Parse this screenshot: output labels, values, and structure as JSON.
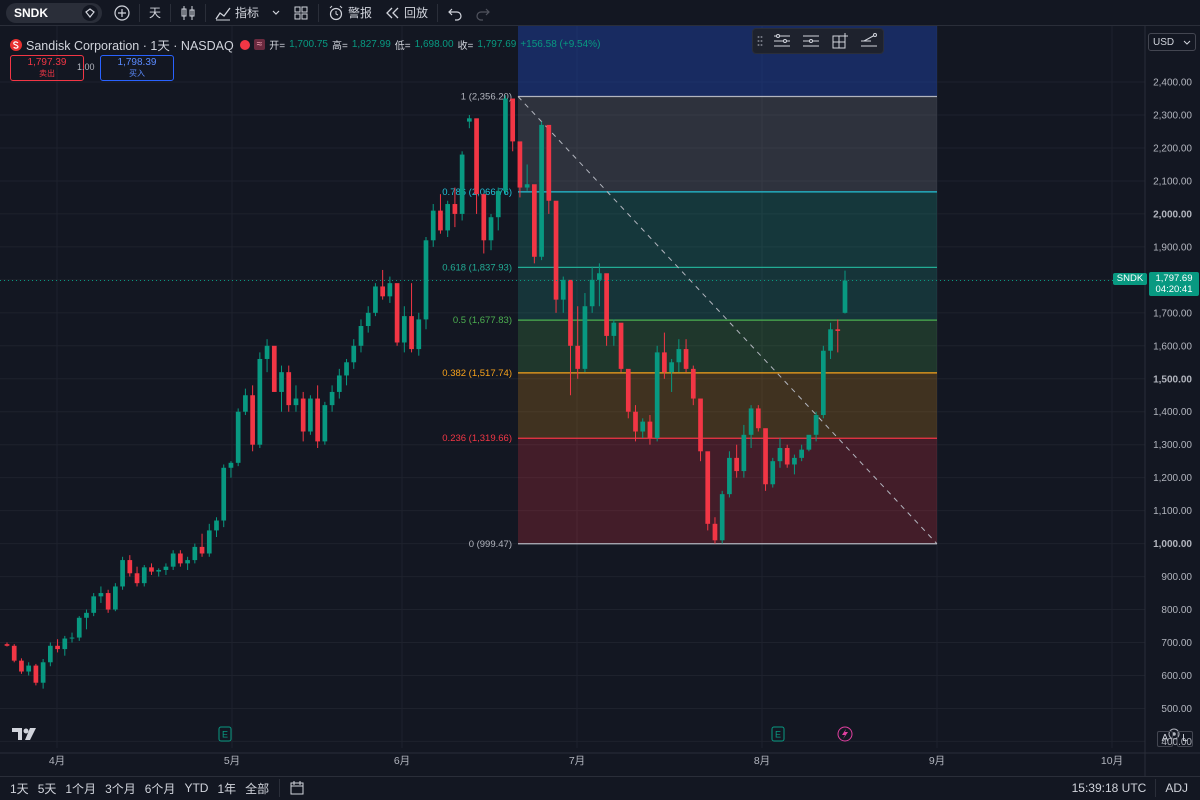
{
  "toolbar": {
    "symbol": "SNDK",
    "interval": "天",
    "indicators": "指标",
    "alert": "警报",
    "replay": "回放"
  },
  "legend": {
    "name": "Sandisk Corporation · 1天 · NASDAQ",
    "open_label": "开=",
    "open": "1,700.75",
    "high_label": "高=",
    "high": "1,827.99",
    "low_label": "低=",
    "low": "1,698.00",
    "close_label": "收=",
    "close": "1,797.69",
    "change": "+156.58 (+9.54%)",
    "sell_price": "1,797.39",
    "sell_label": "卖出",
    "spread": "1.00",
    "buy_price": "1,798.39",
    "buy_label": "买入"
  },
  "currency": "USD",
  "price_label": {
    "symbol": "SNDK",
    "price": "1,797.69",
    "countdown": "04:20:41"
  },
  "colors": {
    "up": "#089981",
    "down": "#f23645",
    "background": "#131722"
  },
  "chart_data": {
    "type": "candlestick",
    "y_axis_ticks": [
      "2,400.00",
      "2,300.00",
      "2,200.00",
      "2,100.00",
      "2,000.00",
      "1,900.00",
      "1,800.00",
      "1,700.00",
      "1,600.00",
      "1,500.00",
      "1,400.00",
      "1,300.00",
      "1,200.00",
      "1,100.00",
      "1,000.00",
      "900.00",
      "800.00",
      "700.00",
      "600.00",
      "500.00",
      "400.00"
    ],
    "y_axis_values": [
      2400,
      2300,
      2200,
      2100,
      2000,
      1900,
      1800,
      1700,
      1600,
      1500,
      1400,
      1300,
      1200,
      1100,
      1000,
      900,
      800,
      700,
      600,
      500,
      400
    ],
    "ylim": [
      380,
      2570
    ],
    "x_axis_ticks": [
      "4月",
      "5月",
      "6月",
      "7月",
      "8月",
      "9月",
      "10月"
    ],
    "grid": true,
    "fibonacci": [
      {
        "label": "1 (2,356.20)",
        "level": 2356.2,
        "color": "#b2b5be"
      },
      {
        "label": "0.786 (2,066.76)",
        "level": 2066.76,
        "color": "#22c1d6"
      },
      {
        "label": "0.618 (1,837.93)",
        "level": 1837.93,
        "color": "#22ab94"
      },
      {
        "label": "0.5 (1,677.83)",
        "level": 1677.83,
        "color": "#4caf50"
      },
      {
        "label": "0.382 (1,517.74)",
        "level": 1517.74,
        "color": "#f7a21b"
      },
      {
        "label": "0.236 (1,319.66)",
        "level": 1319.66,
        "color": "#f23645"
      },
      {
        "label": "0 (999.47)",
        "level": 999.47,
        "color": "#b2b5be"
      }
    ],
    "candles": [
      [
        695,
        700,
        688,
        690
      ],
      [
        690,
        695,
        640,
        645
      ],
      [
        645,
        652,
        605,
        612
      ],
      [
        612,
        640,
        600,
        630
      ],
      [
        630,
        635,
        570,
        578
      ],
      [
        578,
        650,
        560,
        640
      ],
      [
        640,
        700,
        628,
        690
      ],
      [
        690,
        710,
        670,
        680
      ],
      [
        680,
        720,
        660,
        712
      ],
      [
        712,
        730,
        700,
        715
      ],
      [
        715,
        780,
        705,
        775
      ],
      [
        775,
        800,
        740,
        790
      ],
      [
        790,
        850,
        780,
        840
      ],
      [
        840,
        870,
        820,
        850
      ],
      [
        850,
        860,
        790,
        800
      ],
      [
        800,
        880,
        795,
        870
      ],
      [
        870,
        960,
        860,
        950
      ],
      [
        950,
        965,
        900,
        910
      ],
      [
        910,
        930,
        870,
        880
      ],
      [
        880,
        935,
        870,
        928
      ],
      [
        928,
        940,
        905,
        915
      ],
      [
        915,
        925,
        900,
        920
      ],
      [
        920,
        940,
        905,
        930
      ],
      [
        930,
        980,
        920,
        970
      ],
      [
        970,
        980,
        930,
        940
      ],
      [
        940,
        960,
        920,
        950
      ],
      [
        950,
        1000,
        940,
        990
      ],
      [
        990,
        1030,
        960,
        970
      ],
      [
        970,
        1060,
        960,
        1040
      ],
      [
        1040,
        1080,
        1020,
        1070
      ],
      [
        1070,
        1240,
        1050,
        1230
      ],
      [
        1230,
        1250,
        1200,
        1245
      ],
      [
        1245,
        1410,
        1235,
        1400
      ],
      [
        1400,
        1470,
        1390,
        1450
      ],
      [
        1450,
        1480,
        1280,
        1300
      ],
      [
        1300,
        1580,
        1290,
        1560
      ],
      [
        1560,
        1620,
        1520,
        1600
      ],
      [
        1600,
        1520,
        1460,
        1460
      ],
      [
        1460,
        1540,
        1400,
        1520
      ],
      [
        1520,
        1540,
        1400,
        1420
      ],
      [
        1420,
        1480,
        1400,
        1440
      ],
      [
        1440,
        1460,
        1310,
        1340
      ],
      [
        1340,
        1450,
        1330,
        1440
      ],
      [
        1440,
        1480,
        1290,
        1310
      ],
      [
        1310,
        1430,
        1300,
        1420
      ],
      [
        1420,
        1480,
        1400,
        1460
      ],
      [
        1460,
        1530,
        1440,
        1510
      ],
      [
        1510,
        1560,
        1480,
        1550
      ],
      [
        1550,
        1620,
        1530,
        1600
      ],
      [
        1600,
        1680,
        1580,
        1660
      ],
      [
        1660,
        1720,
        1640,
        1700
      ],
      [
        1700,
        1790,
        1690,
        1780
      ],
      [
        1780,
        1830,
        1740,
        1750
      ],
      [
        1750,
        1810,
        1730,
        1790
      ],
      [
        1790,
        1780,
        1600,
        1610
      ],
      [
        1610,
        1720,
        1580,
        1690
      ],
      [
        1690,
        1790,
        1580,
        1590
      ],
      [
        1590,
        1700,
        1570,
        1680
      ],
      [
        1680,
        1930,
        1650,
        1920
      ],
      [
        1920,
        2030,
        1900,
        2010
      ],
      [
        2010,
        2060,
        1940,
        1950
      ],
      [
        1950,
        2040,
        1930,
        2030
      ],
      [
        2030,
        2080,
        1960,
        2000
      ],
      [
        2000,
        2190,
        1980,
        2180
      ],
      [
        2280,
        2300,
        2260,
        2290
      ],
      [
        2290,
        2280,
        2000,
        2060
      ],
      [
        2060,
        2050,
        1880,
        1920
      ],
      [
        1920,
        2000,
        1890,
        1990
      ],
      [
        1990,
        2080,
        1950,
        2070
      ],
      [
        2070,
        2360,
        2060,
        2350
      ],
      [
        2350,
        2340,
        2190,
        2220
      ],
      [
        2220,
        2200,
        2050,
        2080
      ],
      [
        2080,
        2150,
        2070,
        2090
      ],
      [
        2090,
        2080,
        1850,
        1870
      ],
      [
        1870,
        2280,
        1860,
        2270
      ],
      [
        2270,
        2200,
        2000,
        2040
      ],
      [
        2040,
        2000,
        1700,
        1740
      ],
      [
        1740,
        1810,
        1700,
        1800
      ],
      [
        1800,
        1780,
        1450,
        1600
      ],
      [
        1600,
        1720,
        1500,
        1530
      ],
      [
        1530,
        1760,
        1520,
        1720
      ],
      [
        1720,
        1840,
        1700,
        1800
      ],
      [
        1800,
        1850,
        1720,
        1820
      ],
      [
        1820,
        1720,
        1600,
        1630
      ],
      [
        1630,
        1680,
        1600,
        1670
      ],
      [
        1670,
        1650,
        1520,
        1530
      ],
      [
        1530,
        1510,
        1380,
        1400
      ],
      [
        1400,
        1420,
        1310,
        1340
      ],
      [
        1340,
        1380,
        1320,
        1370
      ],
      [
        1370,
        1390,
        1300,
        1320
      ],
      [
        1320,
        1600,
        1310,
        1580
      ],
      [
        1580,
        1640,
        1500,
        1520
      ],
      [
        1520,
        1560,
        1460,
        1550
      ],
      [
        1550,
        1620,
        1520,
        1590
      ],
      [
        1590,
        1620,
        1520,
        1530
      ],
      [
        1530,
        1540,
        1420,
        1440
      ],
      [
        1440,
        1420,
        1250,
        1280
      ],
      [
        1280,
        1230,
        1040,
        1060
      ],
      [
        1060,
        1080,
        1000,
        1010
      ],
      [
        1010,
        1160,
        1000,
        1150
      ],
      [
        1150,
        1280,
        1140,
        1260
      ],
      [
        1260,
        1300,
        1200,
        1220
      ],
      [
        1220,
        1360,
        1200,
        1330
      ],
      [
        1330,
        1420,
        1290,
        1410
      ],
      [
        1410,
        1420,
        1340,
        1350
      ],
      [
        1350,
        1260,
        1160,
        1180
      ],
      [
        1180,
        1260,
        1170,
        1250
      ],
      [
        1250,
        1320,
        1230,
        1290
      ],
      [
        1290,
        1300,
        1230,
        1240
      ],
      [
        1240,
        1270,
        1210,
        1260
      ],
      [
        1260,
        1300,
        1250,
        1285
      ],
      [
        1285,
        1280,
        1320,
        1330
      ],
      [
        1330,
        1400,
        1310,
        1390
      ],
      [
        1390,
        1600,
        1380,
        1585
      ],
      [
        1585,
        1670,
        1560,
        1650
      ],
      [
        1650,
        1680,
        1580,
        1645
      ],
      [
        1700,
        1828,
        1698,
        1798
      ]
    ]
  },
  "bottombar": {
    "ranges": [
      "1天",
      "5天",
      "1个月",
      "3个月",
      "6个月",
      "YTD",
      "1年",
      "全部"
    ],
    "time": "15:39:18 UTC",
    "adj": "ADJ"
  },
  "scale_buttons": [
    "A",
    "L"
  ]
}
